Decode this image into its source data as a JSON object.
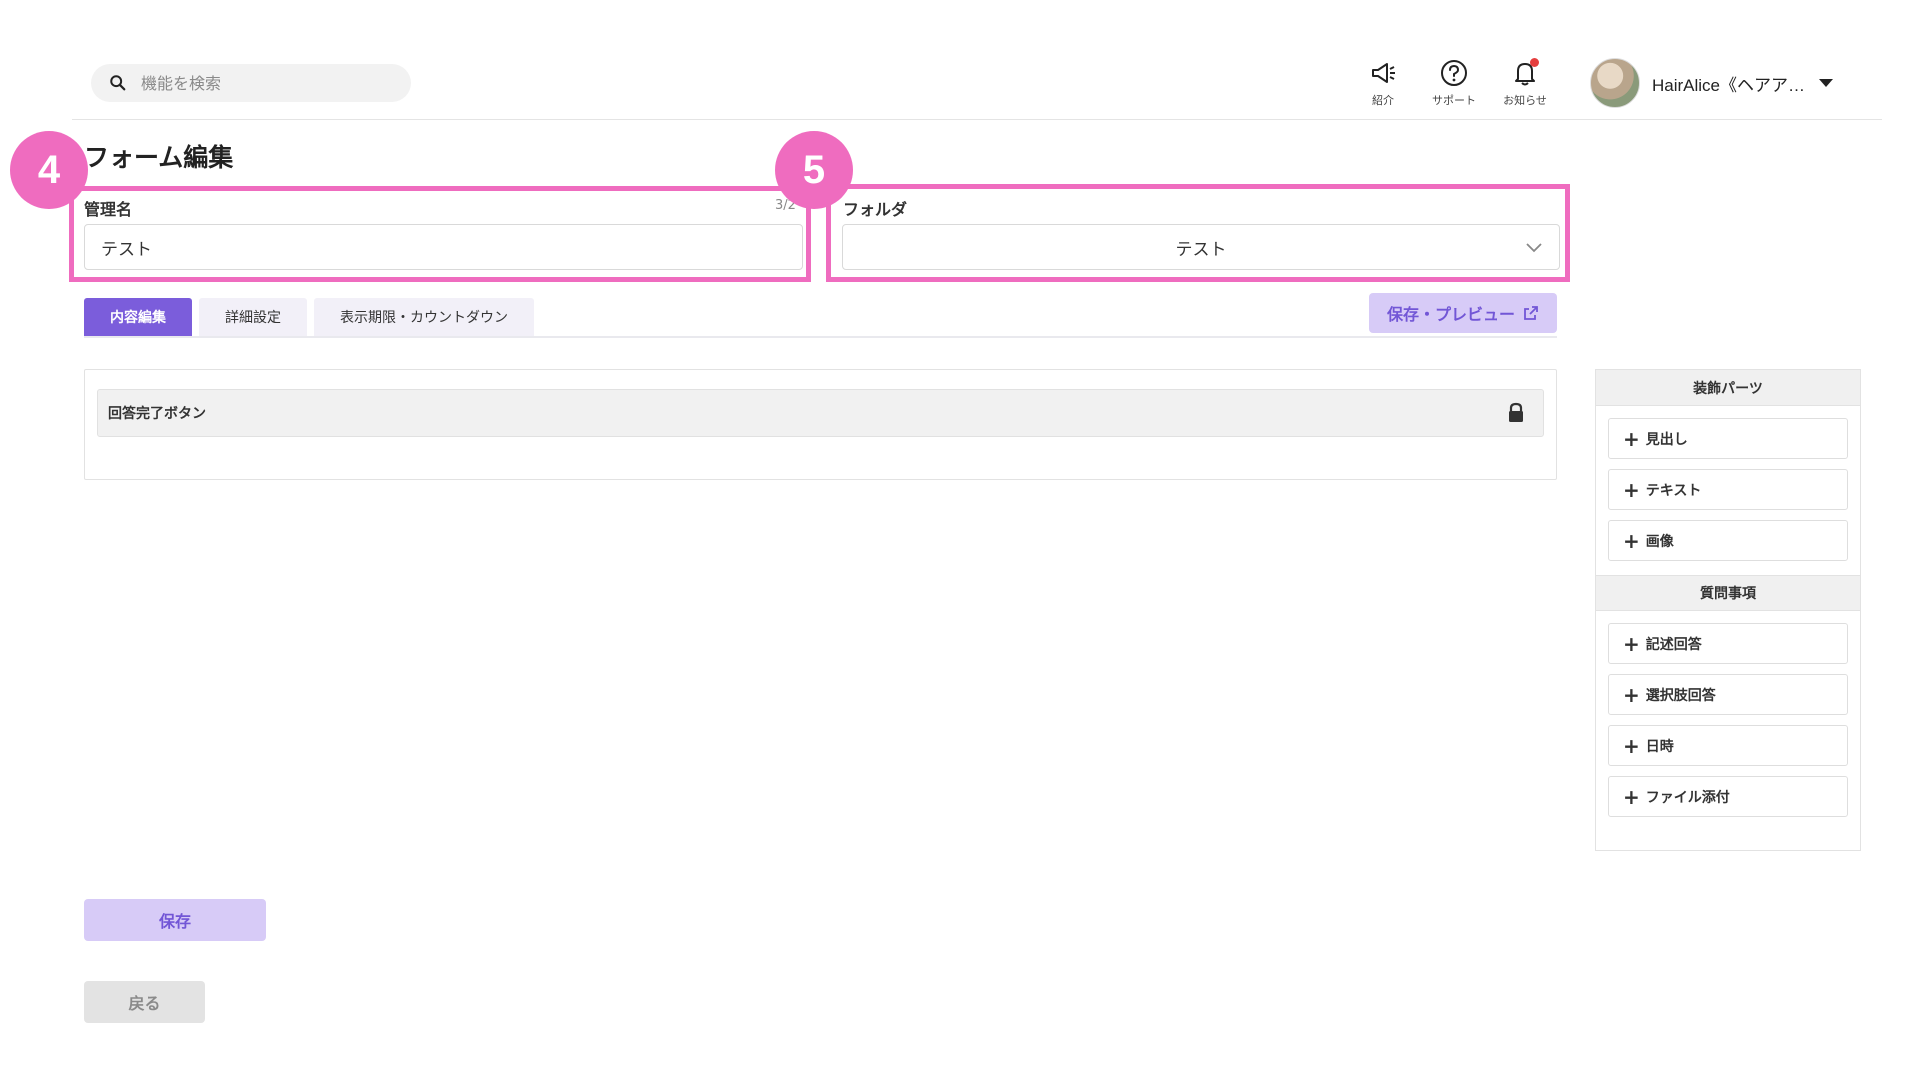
{
  "header": {
    "search_placeholder": "機能を検索",
    "buttons": [
      {
        "icon": "megaphone-icon",
        "label": "紹介"
      },
      {
        "icon": "help-icon",
        "label": "サポート"
      },
      {
        "icon": "bell-icon",
        "label": "お知らせ"
      }
    ],
    "account_name": "HairAlice《ヘアア…"
  },
  "page": {
    "title": "フォーム編集",
    "markers": [
      "4",
      "5"
    ]
  },
  "form": {
    "name_label": "管理名",
    "name_value": "テスト",
    "name_count": "3/2",
    "folder_label": "フォルダ",
    "folder_value": "テスト"
  },
  "tabs": [
    {
      "label": "内容編集",
      "active": true
    },
    {
      "label": "詳細設定",
      "active": false
    },
    {
      "label": "表示期限・カウントダウン",
      "active": false
    }
  ],
  "preview_button": "保存・プレビュー",
  "content": {
    "items": [
      {
        "label": "回答完了ボタン",
        "locked": true
      }
    ]
  },
  "sidebar": {
    "decoration_title": "装飾パーツ",
    "decoration_items": [
      "見出し",
      "テキスト",
      "画像"
    ],
    "question_title": "質問事項",
    "question_items": [
      "記述回答",
      "選択肢回答",
      "日時",
      "ファイル添付"
    ]
  },
  "footer": {
    "save": "保存",
    "back": "戻る"
  },
  "colors": {
    "accent": "#7b5ddb",
    "accent_light": "#d7cbf7",
    "highlight": "#ef6cbf",
    "notification": "#e53e3e"
  }
}
